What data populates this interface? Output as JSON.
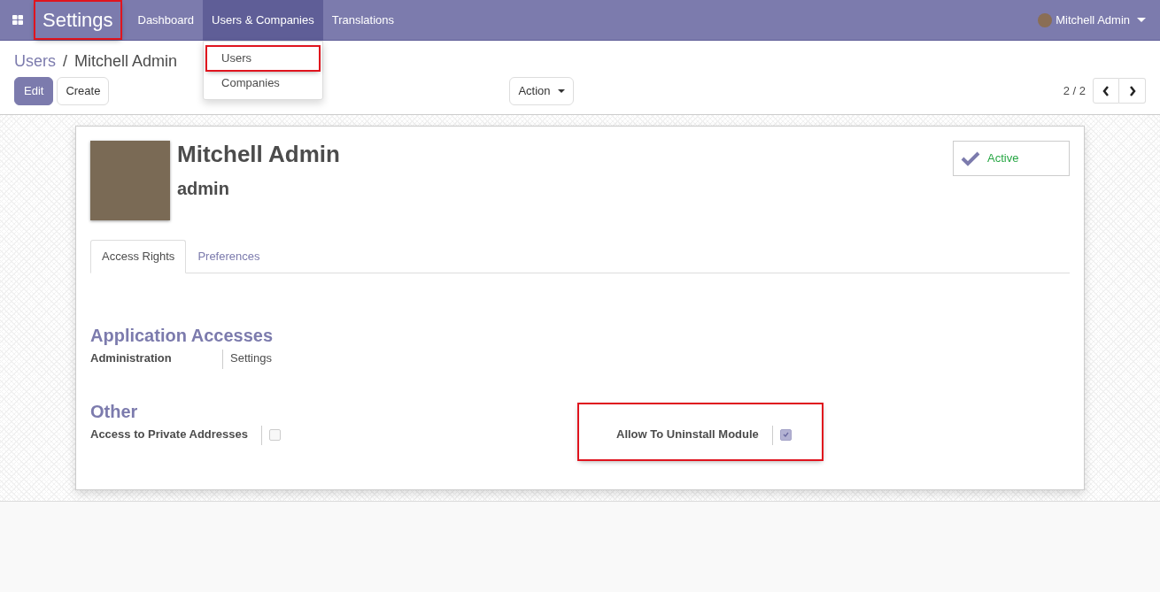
{
  "navbar": {
    "app_title": "Settings",
    "app_title_highlighted": true,
    "user": "Mitchell Admin",
    "menu": [
      {
        "label": "Dashboard",
        "selected": false
      },
      {
        "label": "Users & Companies",
        "selected": true
      },
      {
        "label": "Translations",
        "selected": false
      }
    ]
  },
  "dropdown": {
    "items": [
      {
        "label": "Users",
        "highlighted": true
      },
      {
        "label": "Companies",
        "highlighted": false
      }
    ]
  },
  "breadcrumb": [
    {
      "label": "Users",
      "kind": "link"
    },
    {
      "label": "/",
      "kind": "separator"
    },
    {
      "label": "Mitchell Admin",
      "kind": "current"
    }
  ],
  "buttons": [
    {
      "label": "Edit",
      "kind": "primary"
    },
    {
      "label": "Create",
      "kind": "secondary"
    }
  ],
  "action": "Action",
  "pager": "2 / 2",
  "form": {
    "name": "Mitchell Admin",
    "login": "admin",
    "active_label": "Active",
    "active": true,
    "tabs": [
      {
        "label": "Access Rights",
        "selected": true
      },
      {
        "label": "Preferences",
        "selected": false
      }
    ],
    "sections": [
      {
        "title": "Application Accesses",
        "fields": [
          {
            "label": "Administration",
            "kind": "text",
            "value": "Settings",
            "highlighted": false
          }
        ]
      },
      {
        "title": "Other",
        "fields": [
          {
            "label": "Access to Private Addresses",
            "kind": "checkbox",
            "checked": false,
            "highlighted": false
          },
          {
            "label": "Allow To Uninstall Module",
            "kind": "checkbox",
            "checked": true,
            "highlighted": true
          }
        ]
      }
    ]
  }
}
